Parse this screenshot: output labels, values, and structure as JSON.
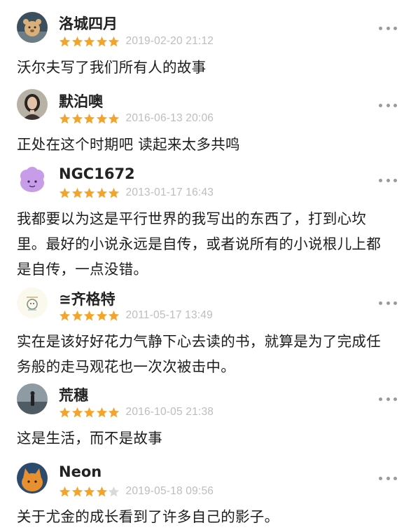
{
  "reviews": [
    {
      "author": "洛城四月",
      "stars": 5,
      "time": "2019-02-20 21:12",
      "content": "沃尔夫写了我们所有人的故事",
      "avatar_icon": "bear-avatar-icon"
    },
    {
      "author": "默泊噢",
      "stars": 5,
      "time": "2016-06-13 20:06",
      "content": "正处在这个时期吧 读起来太多共鸣",
      "avatar_icon": "woman-portrait-avatar-icon"
    },
    {
      "author": "NGC1672",
      "stars": 5,
      "time": "2013-01-17 16:43",
      "content": "我都要以为这是平行世界的我写出的东西了，打到心坎里。最好的小说永远是自传，或者说所有的小说根儿上都是自传，一点没错。",
      "avatar_icon": "purple-cloud-avatar-icon"
    },
    {
      "author": "≅齐格特",
      "stars": 5,
      "time": "2011-05-17 13:49",
      "content": "实在是该好好花力气静下心去读的书，就算是为了完成任务般的走马观花也一次次被击中。",
      "avatar_icon": "doodle-avatar-icon"
    },
    {
      "author": "荒穗",
      "stars": 5,
      "time": "2016-10-05 21:38",
      "content": "这是生活，而不是故事",
      "avatar_icon": "seaside-figure-avatar-icon"
    },
    {
      "author": "Neon",
      "stars": 4,
      "time": "2019-05-18 09:56",
      "content": "关于尤金的成长看到了许多自己的影子。",
      "avatar_icon": "orange-cat-avatar-icon"
    }
  ],
  "colors": {
    "star_filled": "#f4a42b",
    "star_empty": "#d9d9d9",
    "timestamp": "#bdbdbd",
    "more_dots": "#9a9a9a"
  }
}
